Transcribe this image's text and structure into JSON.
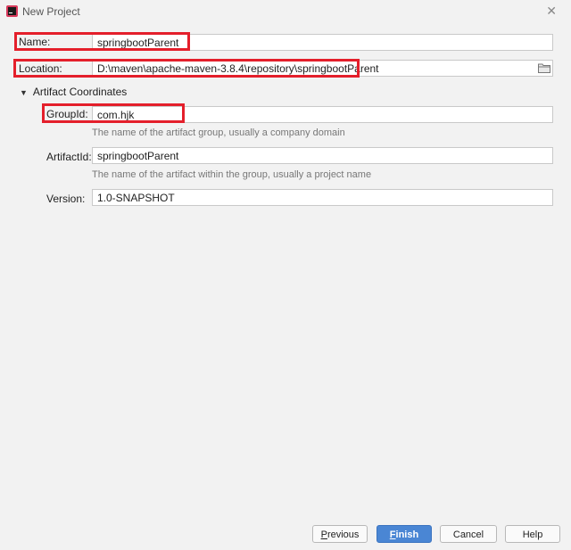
{
  "window": {
    "title": "New Project"
  },
  "name": {
    "label": "Name:",
    "value": "springbootParent"
  },
  "location": {
    "label": "Location:",
    "value": "D:\\maven\\apache-maven-3.8.4\\repository\\springbootParent"
  },
  "artifact": {
    "section_label": "Artifact Coordinates",
    "group_id": {
      "label": "GroupId:",
      "value": "com.hjk",
      "hint": "The name of the artifact group, usually a company domain"
    },
    "artifact_id": {
      "label": "ArtifactId:",
      "value": "springbootParent",
      "hint": "The name of the artifact within the group, usually a project name"
    },
    "version": {
      "label": "Version:",
      "value": "1.0-SNAPSHOT"
    }
  },
  "buttons": {
    "previous": {
      "mnemonic": "P",
      "rest": "revious"
    },
    "finish": {
      "mnemonic": "F",
      "rest": "inish"
    },
    "cancel": "Cancel",
    "help": "Help"
  },
  "colors": {
    "highlight": "#e41f2b",
    "primary_button": "#4a86d4"
  },
  "icons": {
    "app": "intellij-app-icon",
    "close": "close-icon",
    "browse": "folder-icon"
  }
}
